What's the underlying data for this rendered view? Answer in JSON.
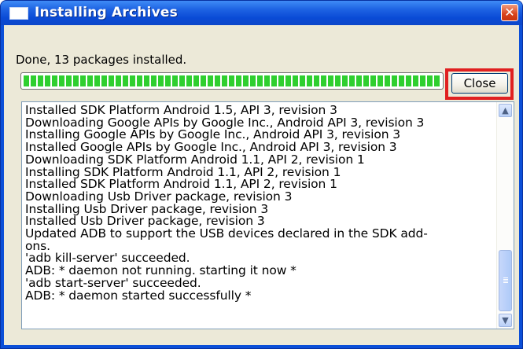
{
  "window": {
    "title": "Installing Archives",
    "close_glyph": "✕",
    "icon": "window-app-icon",
    "close_color": "#d9431c",
    "titlebar_color": "#0a4bd6"
  },
  "status": {
    "text": "Done, 13 packages installed."
  },
  "progress": {
    "percent": 100,
    "color": "#2fcf2f"
  },
  "buttons": {
    "close_label": "Close",
    "highlight_color": "#e02020"
  },
  "log": {
    "lines": [
      "Installed SDK Platform Android 1.5, API 3, revision 3",
      "Downloading Google APIs by Google Inc., Android API 3, revision 3",
      "Installing Google APIs by Google Inc., Android API 3, revision 3",
      "Installed Google APIs by Google Inc., Android API 3, revision 3",
      "Downloading SDK Platform Android 1.1, API 2, revision 1",
      "Installing SDK Platform Android 1.1, API 2, revision 1",
      "Installed SDK Platform Android 1.1, API 2, revision 1",
      "Downloading Usb Driver package, revision 3",
      "Installing Usb Driver package, revision 3",
      "Installed Usb Driver package, revision 3",
      "Updated ADB to support the USB devices declared in the SDK add-",
      "ons.",
      "'adb kill-server' succeeded.",
      "ADB: * daemon not running. starting it now *",
      "'adb start-server' succeeded.",
      "ADB: * daemon started successfully *"
    ],
    "scroll_up_glyph": "▲",
    "scroll_down_glyph": "▼"
  }
}
